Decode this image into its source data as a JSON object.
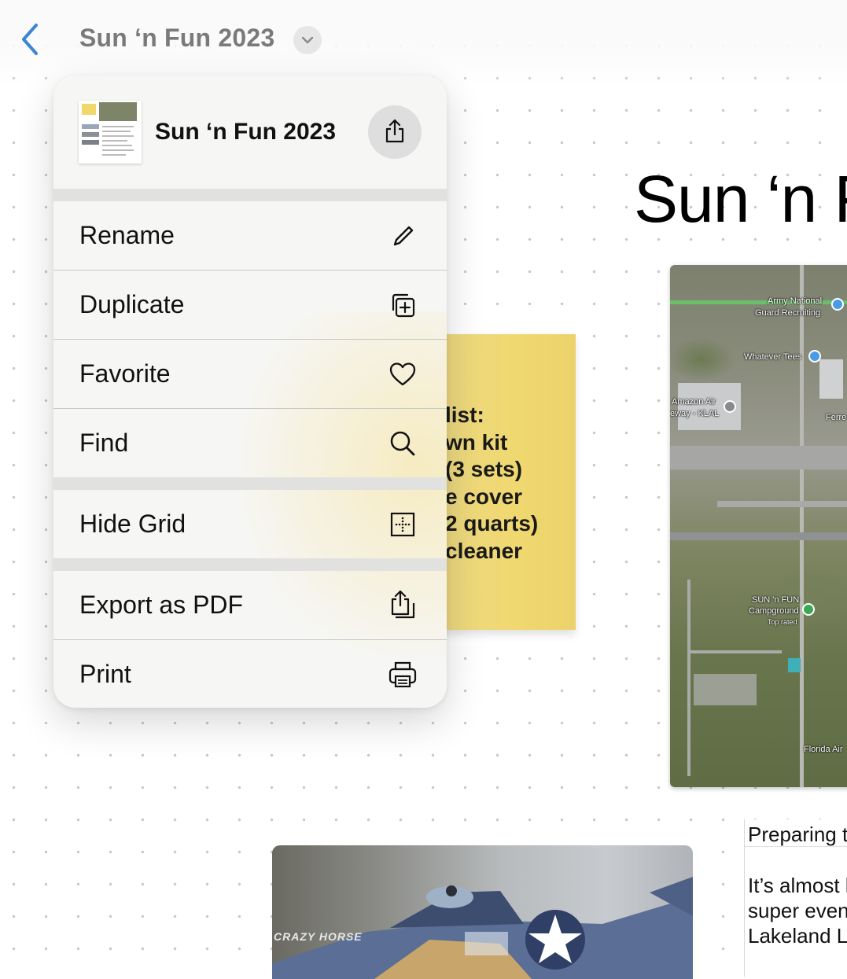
{
  "app": {
    "document_title": "Sun ‘n Fun 2023"
  },
  "menu": {
    "header_title": "Sun ‘n Fun 2023",
    "items": [
      {
        "label": "Rename",
        "icon": "pencil-icon"
      },
      {
        "label": "Duplicate",
        "icon": "duplicate-icon"
      },
      {
        "label": "Favorite",
        "icon": "heart-icon"
      },
      {
        "label": "Find",
        "icon": "search-icon"
      },
      {
        "label": "Hide Grid",
        "icon": "grid-icon"
      },
      {
        "label": "Export as PDF",
        "icon": "export-icon"
      },
      {
        "label": "Print",
        "icon": "printer-icon"
      }
    ]
  },
  "board": {
    "big_title": "Sun ‘n F",
    "sticky_lines": [
      " list:",
      "wn kit",
      "(3 sets)",
      "e cover",
      "2 quarts)",
      "cleaner"
    ],
    "map_labels": [
      "Army National",
      "Guard Recruiting",
      "Whatever Tees",
      "Amazon Air",
      "eway - KLAL",
      "Ferre",
      "SUN 'n FUN",
      "Campground",
      "Top rated",
      "Florida Air"
    ],
    "notes_heading": "Preparing to",
    "notes_body": [
      "It’s almost he",
      "super event,",
      "Lakeland Lin"
    ],
    "photo_text": "CRAZY HORSE"
  },
  "colors": {
    "accent_blue": "#3a86d4",
    "sticky_yellow": "#f0d870"
  }
}
